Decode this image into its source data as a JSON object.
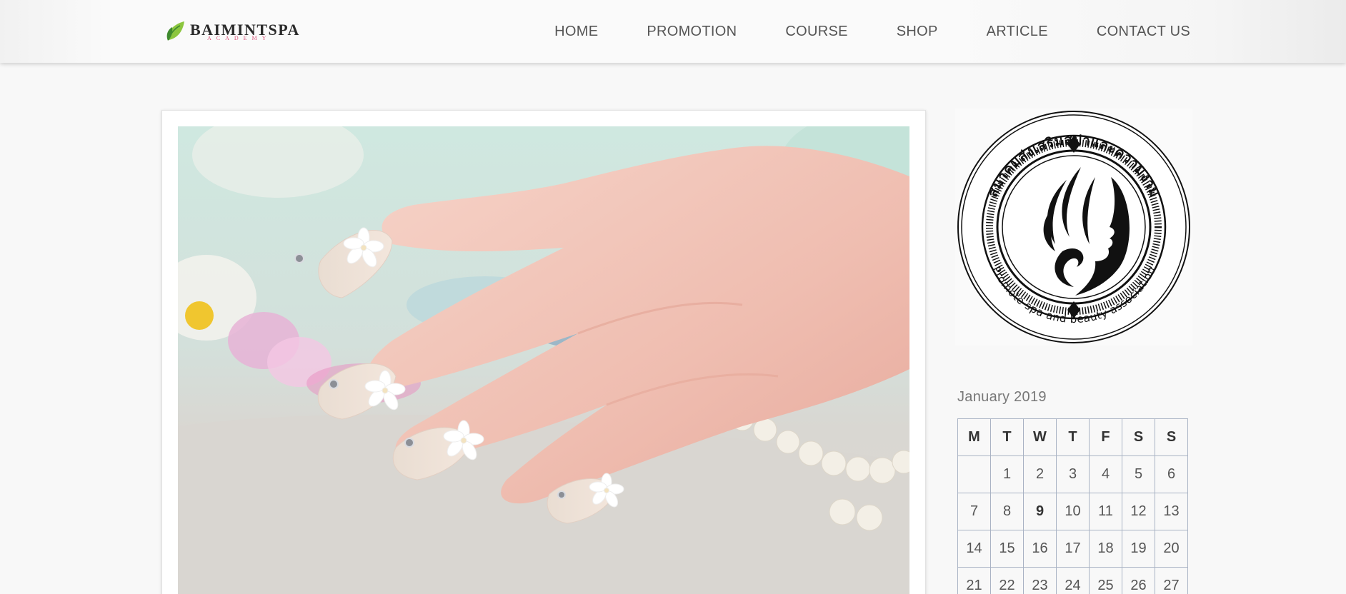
{
  "brand": {
    "name": "BAIMINTSPA",
    "tagline": "ACADEMY",
    "colors": {
      "leaf_dark": "#3f8a2e",
      "leaf_light": "#8cc63f",
      "tagline": "#d9577c"
    }
  },
  "nav": {
    "items": [
      {
        "label": "HOME"
      },
      {
        "label": "PROMOTION"
      },
      {
        "label": "COURSE"
      },
      {
        "label": "SHOP"
      },
      {
        "label": "ARTICLE"
      },
      {
        "label": "CONTACT US"
      }
    ]
  },
  "post": {
    "image": {
      "subject": "manicured hand with white flower nail art and pearls",
      "palette": [
        "#cfe6de",
        "#f2c9bd",
        "#ffffff",
        "#dad7d2"
      ]
    }
  },
  "seal": {
    "thai_text": "สมาคมส่งเสริมสปาและความงาม",
    "english_text": "Promote spa and beauty association"
  },
  "calendar": {
    "caption": "January 2019",
    "weekdays": [
      "M",
      "T",
      "W",
      "T",
      "F",
      "S",
      "S"
    ],
    "weeks": [
      [
        "",
        "1",
        "2",
        "3",
        "4",
        "5",
        "6"
      ],
      [
        "7",
        "8",
        "9",
        "10",
        "11",
        "12",
        "13"
      ],
      [
        "14",
        "15",
        "16",
        "17",
        "18",
        "19",
        "20"
      ],
      [
        "21",
        "22",
        "23",
        "24",
        "25",
        "26",
        "27"
      ]
    ],
    "today": "9",
    "border_color": "#a9b3c4"
  }
}
